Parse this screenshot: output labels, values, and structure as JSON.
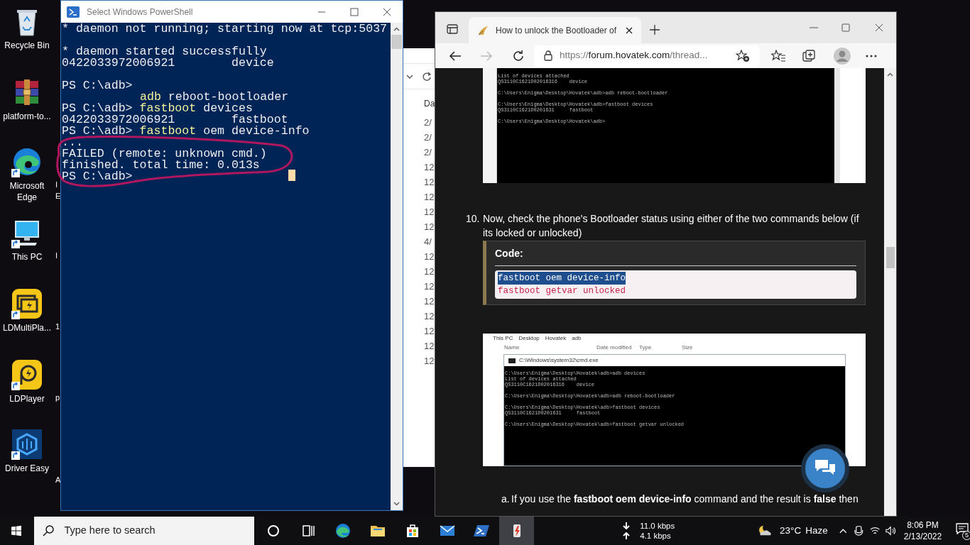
{
  "desktop": {
    "icons": [
      {
        "label": "Recycle Bin",
        "kind": "recycle-bin",
        "shortcut": false
      },
      {
        "label": "platform-to...",
        "kind": "archive",
        "shortcut": false
      },
      {
        "label": "Microsoft Edge",
        "kind": "edge",
        "shortcut": true
      },
      {
        "label": "This PC",
        "kind": "computer",
        "shortcut": true
      },
      {
        "label": "LDMultiPla...",
        "kind": "ld-multi",
        "shortcut": true
      },
      {
        "label": "LDPlayer",
        "kind": "ld-player",
        "shortcut": true
      },
      {
        "label": "Driver Easy",
        "kind": "driver-easy",
        "shortcut": true
      }
    ],
    "partial_labels": [
      "I",
      "E",
      "I",
      "1",
      "p",
      "A"
    ]
  },
  "explorer": {
    "column_header": "Da",
    "dates": [
      "2/",
      "2/",
      "2/",
      "12",
      "12",
      "12",
      "12",
      "12",
      "4/",
      "12",
      "12",
      "12",
      "12",
      "12",
      "12",
      "12",
      "12"
    ]
  },
  "powershell": {
    "title": "Select Windows PowerShell",
    "blocks": [
      [
        [
          {
            "text": "* daemon not running; starting now at tcp:5037",
            "kind": "output"
          }
        ]
      ],
      [
        [
          {
            "text": "* daemon started successfully",
            "kind": "output"
          }
        ],
        [
          {
            "text": "0422033972006921        device",
            "kind": "output"
          }
        ]
      ],
      [
        [
          {
            "text": "PS C:\\adb>",
            "kind": "output"
          }
        ],
        [
          {
            "text": "adb",
            "kind": "command",
            "indent": true
          },
          {
            "text": " reboot-bootloader",
            "kind": "output"
          }
        ],
        [
          {
            "text": "PS C:\\adb> ",
            "kind": "output"
          },
          {
            "text": "fastboot",
            "kind": "command"
          },
          {
            "text": " devices",
            "kind": "output"
          }
        ],
        [
          {
            "text": "0422033972006921        fastboot",
            "kind": "output"
          }
        ],
        [
          {
            "text": "PS C:\\adb> ",
            "kind": "output"
          },
          {
            "text": "fastboot",
            "kind": "command"
          },
          {
            "text": " oem device-info",
            "kind": "output"
          }
        ],
        [
          {
            "text": "...",
            "kind": "output"
          }
        ],
        [
          {
            "text": "FAILED (remote: unknown cmd.)",
            "kind": "output"
          }
        ],
        [
          {
            "text": "finished. total time: 0.013s",
            "kind": "output"
          }
        ],
        [
          {
            "text": "PS C:\\adb>",
            "kind": "output"
          }
        ]
      ]
    ]
  },
  "browser": {
    "tab": {
      "title": "How to unlock the Bootloader of",
      "selected": true
    },
    "url": {
      "scheme": "https://",
      "host": "forum.hovatek.com",
      "path": "/thread..."
    },
    "forward_disabled": true,
    "article": {
      "screenshot_1": {
        "blocks": [
          [
            "List of devices attached",
            "QS3110C1621D02016316    device"
          ],
          [
            "C:\\Users\\Enigma\\Desktop\\Hovatek\\adb>adb reboot-bootloader"
          ],
          [
            "C:\\Users\\Enigma\\Desktop\\Hovatek\\adb>fastboot devices",
            "QS3110C1621D0201631     fastboot"
          ],
          [
            "C:\\Users\\Enigma\\Desktop\\Hovatek\\adb>"
          ]
        ]
      },
      "step": {
        "number": "10.",
        "text": "Now, check the phone's Bootloader status using either of the two commands below (if its locked or unlocked)"
      },
      "code": {
        "title": "Code:",
        "lines": [
          {
            "text": "fastboot oem device-info",
            "selected": true
          },
          {
            "text": "fastboot getvar unlocked",
            "selected": false
          }
        ]
      },
      "screenshot_2": {
        "breadcrumb": [
          "This PC",
          "Desktop",
          "Hovatek",
          "adb"
        ],
        "columns": [
          "Name",
          "Date modified",
          "Type",
          "Size"
        ],
        "window_title": "C:\\Windows\\system32\\cmd.exe",
        "blocks": [
          [
            "C:\\Users\\Enigma\\Desktop\\Hovatek\\adb>adb devices",
            "List of devices attached",
            "QS3110C1621D02016316    device"
          ],
          [
            "C:\\Users\\Enigma\\Desktop\\Hovatek\\adb>adb reboot-bootloader"
          ],
          [
            "C:\\Users\\Enigma\\Desktop\\Hovatek\\adb>fastboot devices",
            "QS3110C1621D0201631     fastboot"
          ],
          [
            "C:\\Users\\Enigma\\Desktop\\Hovatek\\adb>fastboot getvar unlocked"
          ]
        ]
      },
      "substep": {
        "number": "a.",
        "text": "If you use the **fastboot oem device-info** command and the result is **false** then"
      }
    }
  },
  "taskbar": {
    "search_placeholder": "Type here to search",
    "apps": [
      {
        "kind": "cortana",
        "selected": false
      },
      {
        "kind": "task-view",
        "selected": false
      },
      {
        "kind": "edge",
        "selected": false
      },
      {
        "kind": "folder",
        "selected": false
      },
      {
        "kind": "store",
        "selected": false
      },
      {
        "kind": "mail",
        "selected": false
      },
      {
        "kind": "powershell",
        "selected": false
      },
      {
        "kind": "flash-tool",
        "selected": true
      }
    ],
    "network": {
      "download": "11.0 kbps",
      "upload": "4.1 kbps"
    },
    "weather": {
      "temperature": "23°C",
      "condition": "Haze"
    },
    "clock": {
      "time": "8:06 PM",
      "date": "2/13/2022"
    },
    "notifications": {
      "count": "5"
    }
  }
}
